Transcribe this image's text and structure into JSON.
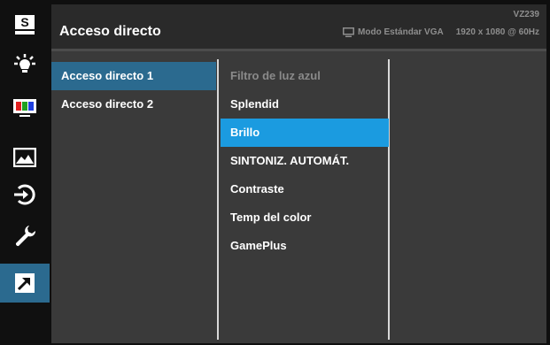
{
  "sidebar": {
    "items": [
      {
        "icon": "splendid-s-icon",
        "active": false
      },
      {
        "icon": "blue-light-filter-icon",
        "active": false
      },
      {
        "icon": "color-icon",
        "active": false
      },
      {
        "icon": "image-icon",
        "active": false
      },
      {
        "icon": "input-select-icon",
        "active": false
      },
      {
        "icon": "system-setup-wrench-icon",
        "active": false
      },
      {
        "icon": "shortcut-arrow-icon",
        "active": true
      }
    ]
  },
  "header": {
    "title": "Acceso directo",
    "model": "VZ239",
    "mode": "Modo Estándar VGA",
    "resolution": "1920 x 1080 @ 60Hz"
  },
  "submenu": {
    "items": [
      {
        "label": "Acceso directo 1",
        "selected": true
      },
      {
        "label": "Acceso directo 2",
        "selected": false
      }
    ]
  },
  "options": {
    "items": [
      {
        "label": "Filtro de luz azul",
        "state": "disabled"
      },
      {
        "label": "Splendid",
        "state": "normal"
      },
      {
        "label": "Brillo",
        "state": "selected"
      },
      {
        "label": "SINTONIZ. AUTOMÁT.",
        "state": "normal"
      },
      {
        "label": "Contraste",
        "state": "normal"
      },
      {
        "label": "Temp del color",
        "state": "normal"
      },
      {
        "label": "GamePlus",
        "state": "normal"
      }
    ]
  },
  "colors": {
    "accent_selected": "#1b9be0",
    "accent_active": "#2b6a8f",
    "panel": "#3a3a3a",
    "header": "#2a2a2a"
  }
}
